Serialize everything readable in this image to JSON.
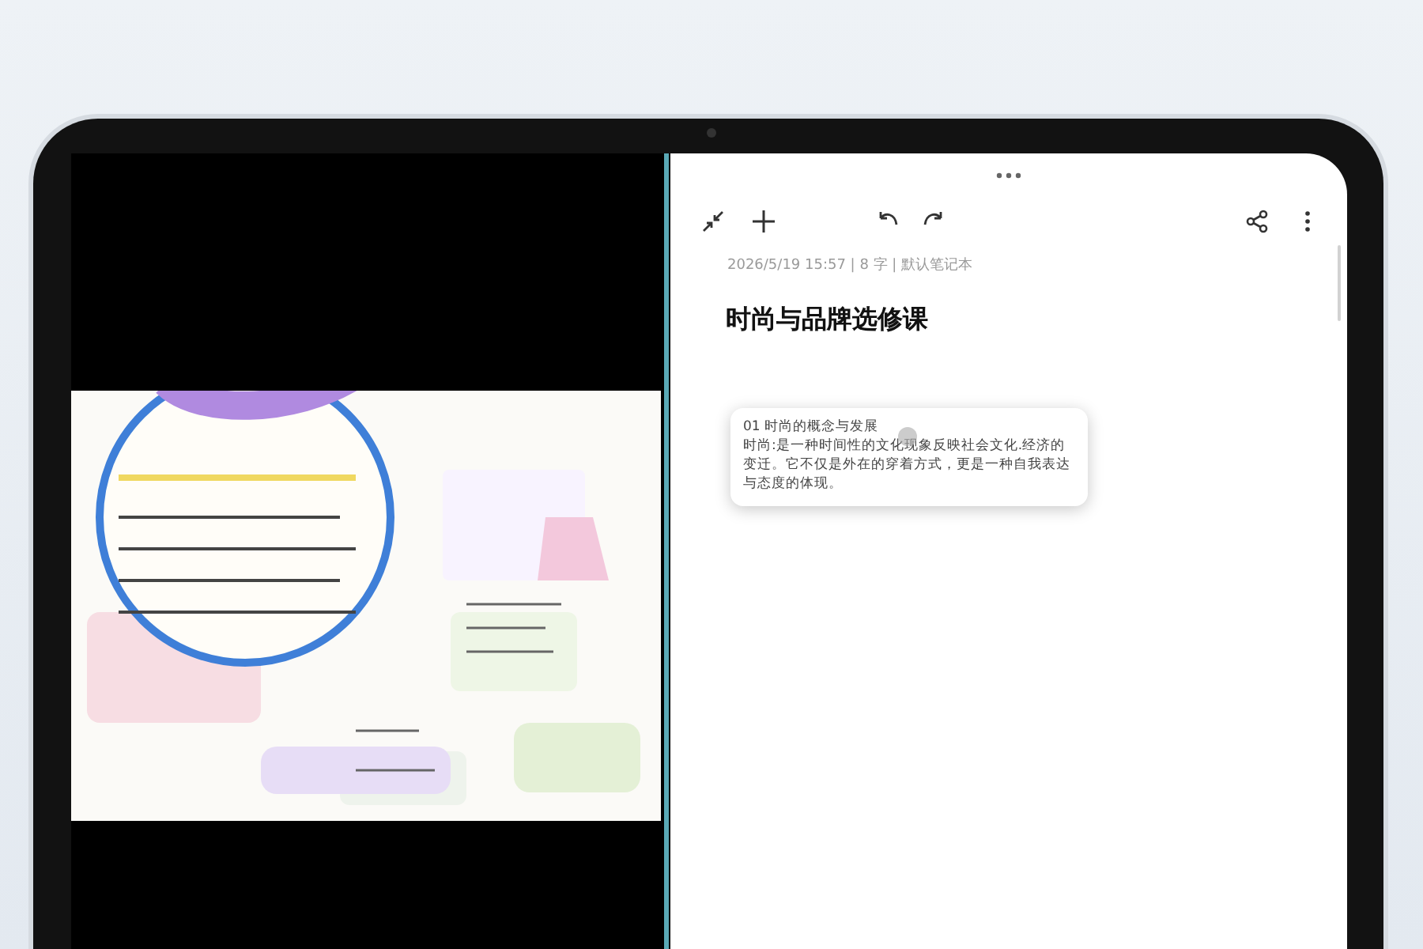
{
  "note": {
    "meta": "2026/5/19 15:57 | 8 字 | 默认笔记本",
    "title": "时尚与品牌选修课",
    "card": {
      "heading": "01 时尚的概念与发展",
      "body": "时尚:是一种时间性的文化现象反映社会文化.经济的变迁。它不仅是外在的穿着方式，更是一种自我表达与态度的体现。"
    }
  }
}
